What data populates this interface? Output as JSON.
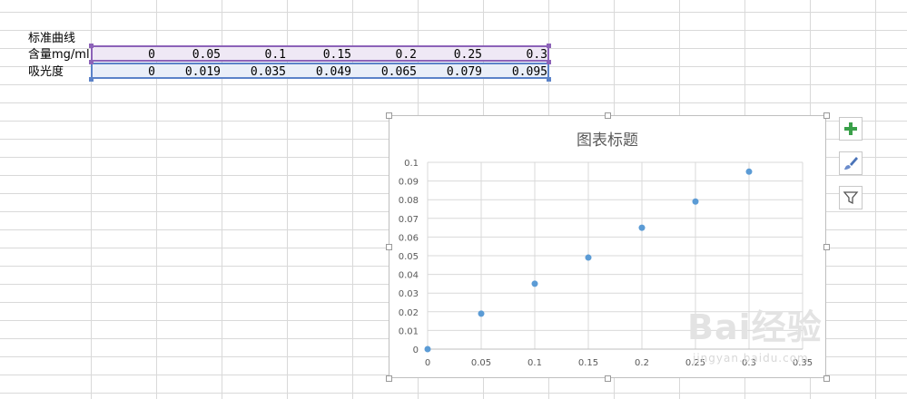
{
  "sheet": {
    "title_cell": "标准曲线",
    "row_content": {
      "label": "含量mg/ml",
      "values": [
        "0",
        "0.05",
        "0.1",
        "0.15",
        "0.2",
        "0.25",
        "0.3"
      ]
    },
    "row_absorbance": {
      "label": "吸光度",
      "values": [
        "0",
        "0.019",
        "0.035",
        "0.049",
        "0.065",
        "0.079",
        "0.095"
      ]
    },
    "colors": {
      "range_purple": "#8c62b8",
      "range_blue": "#5b82c8",
      "marker": "#5b9bd5"
    }
  },
  "chart_data": {
    "type": "scatter",
    "title": "图表标题",
    "x": [
      0,
      0.05,
      0.1,
      0.15,
      0.2,
      0.25,
      0.3
    ],
    "y": [
      0,
      0.019,
      0.035,
      0.049,
      0.065,
      0.079,
      0.095
    ],
    "xlim": [
      0,
      0.35
    ],
    "ylim": [
      0,
      0.1
    ],
    "x_ticks": [
      "0",
      "0.05",
      "0.1",
      "0.15",
      "0.2",
      "0.25",
      "0.3",
      "0.35"
    ],
    "y_ticks": [
      "0",
      "0.01",
      "0.02",
      "0.03",
      "0.04",
      "0.05",
      "0.06",
      "0.07",
      "0.08",
      "0.09",
      "0.1"
    ],
    "grid": true,
    "marker_color": "#5b9bd5"
  },
  "chart_tools": {
    "elements_icon": "plus-icon",
    "styles_icon": "brush-icon",
    "filter_icon": "filter-icon"
  },
  "watermark": {
    "text": "Bai经验",
    "sub": "jingyan.baidu.com"
  }
}
